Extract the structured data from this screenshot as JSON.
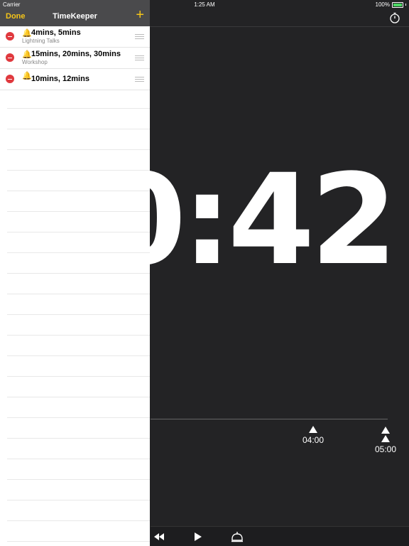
{
  "status": {
    "carrier": "Carrier",
    "time": "1:25 AM",
    "battery": "100%"
  },
  "panel": {
    "done_label": "Done",
    "title": "TimeKeeper",
    "add_label": "+",
    "items": [
      {
        "bell": "🔔",
        "times": "4mins, 5mins",
        "name": "Lightning Talks"
      },
      {
        "bell": "🔔",
        "times": "15mins, 20mins, 30mins",
        "name": "Workshop"
      },
      {
        "bell": "🔔",
        "times": "10mins, 12mins",
        "name": ""
      }
    ]
  },
  "timer": {
    "display": "0:42"
  },
  "markers": {
    "first": "04:00",
    "second": "05:00"
  },
  "colors": {
    "accent": "#f5c518",
    "delete": "#e0393e",
    "background": "#232325"
  }
}
